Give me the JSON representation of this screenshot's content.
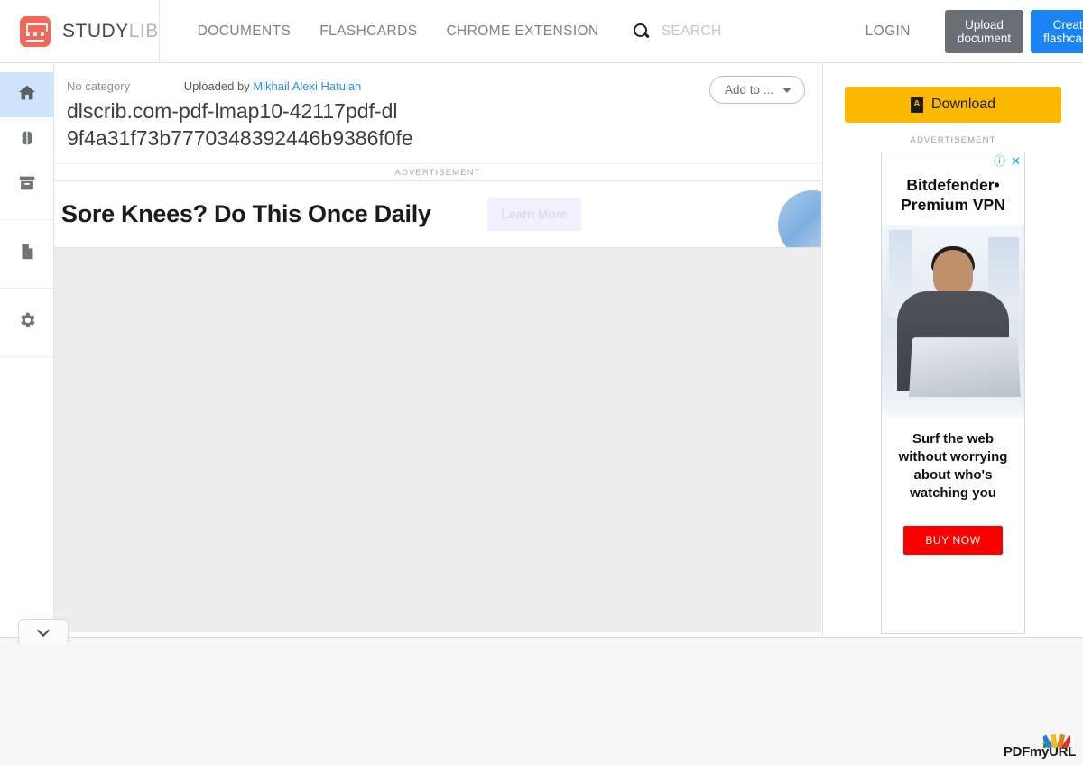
{
  "header": {
    "brand": {
      "part1": "STUDY",
      "part2": "LIB",
      "icon": "studylib-logo-icon"
    },
    "nav": [
      {
        "label": "DOCUMENTS",
        "name": "nav-documents"
      },
      {
        "label": "FLASHCARDS",
        "name": "nav-flashcards"
      },
      {
        "label": "CHROME EXTENSION",
        "name": "nav-chrome-extension"
      }
    ],
    "search": {
      "placeholder": "SEARCH",
      "value": "",
      "icon": "search-icon"
    },
    "login_label": "LOGIN",
    "upload_label": "Upload document",
    "create_flashcards_label": "Create flashcards",
    "colors": {
      "brand": "#f4685a",
      "primary": "#1a84f5",
      "upload": "#6a6f76"
    }
  },
  "sidebar": {
    "items": [
      {
        "name": "sidebar-item-home",
        "icon": "home-icon",
        "active": true
      },
      {
        "name": "sidebar-item-flashcards",
        "icon": "brain-icon",
        "active": false
      },
      {
        "name": "sidebar-item-archive",
        "icon": "archive-box-icon",
        "active": false
      },
      {
        "name": "sidebar-item-documents",
        "icon": "document-icon",
        "active": false
      },
      {
        "name": "sidebar-item-settings",
        "icon": "gear-icon",
        "active": false
      }
    ]
  },
  "document": {
    "category": "No category",
    "uploaded_by_label": "Uploaded by",
    "author": "Mikhail Alexi Hatulan",
    "title": "dlscrib.com-pdf-lmap10-42117pdf-dl 9f4a31f73b7770348392446b9386f0fe",
    "add_to_label": "Add to ...",
    "add_to_icon": "chevron-down-icon"
  },
  "banner_ad": {
    "label": "ADVERTISEMENT",
    "headline": "Sore Knees? Do This Once Daily",
    "cta": "Learn More"
  },
  "right_panel": {
    "download_label": "Download",
    "download_icon": "pdf-file-icon",
    "download_color": "#fcb900",
    "ad_label": "ADVERTISEMENT",
    "ad": {
      "info_icon": "info-circle-icon",
      "close_icon": "close-icon",
      "brand_line1": "Bitdefender•",
      "brand_line2": "Premium VPN",
      "tagline": "Surf the web without worrying about who's watching you",
      "cta": "BUY NOW",
      "cta_color": "#fc0000"
    }
  },
  "footer": {
    "collapse_icon": "chevron-down-icon",
    "watermark": {
      "part1": "PDF",
      "part2": "my",
      "part3": "URL"
    }
  }
}
